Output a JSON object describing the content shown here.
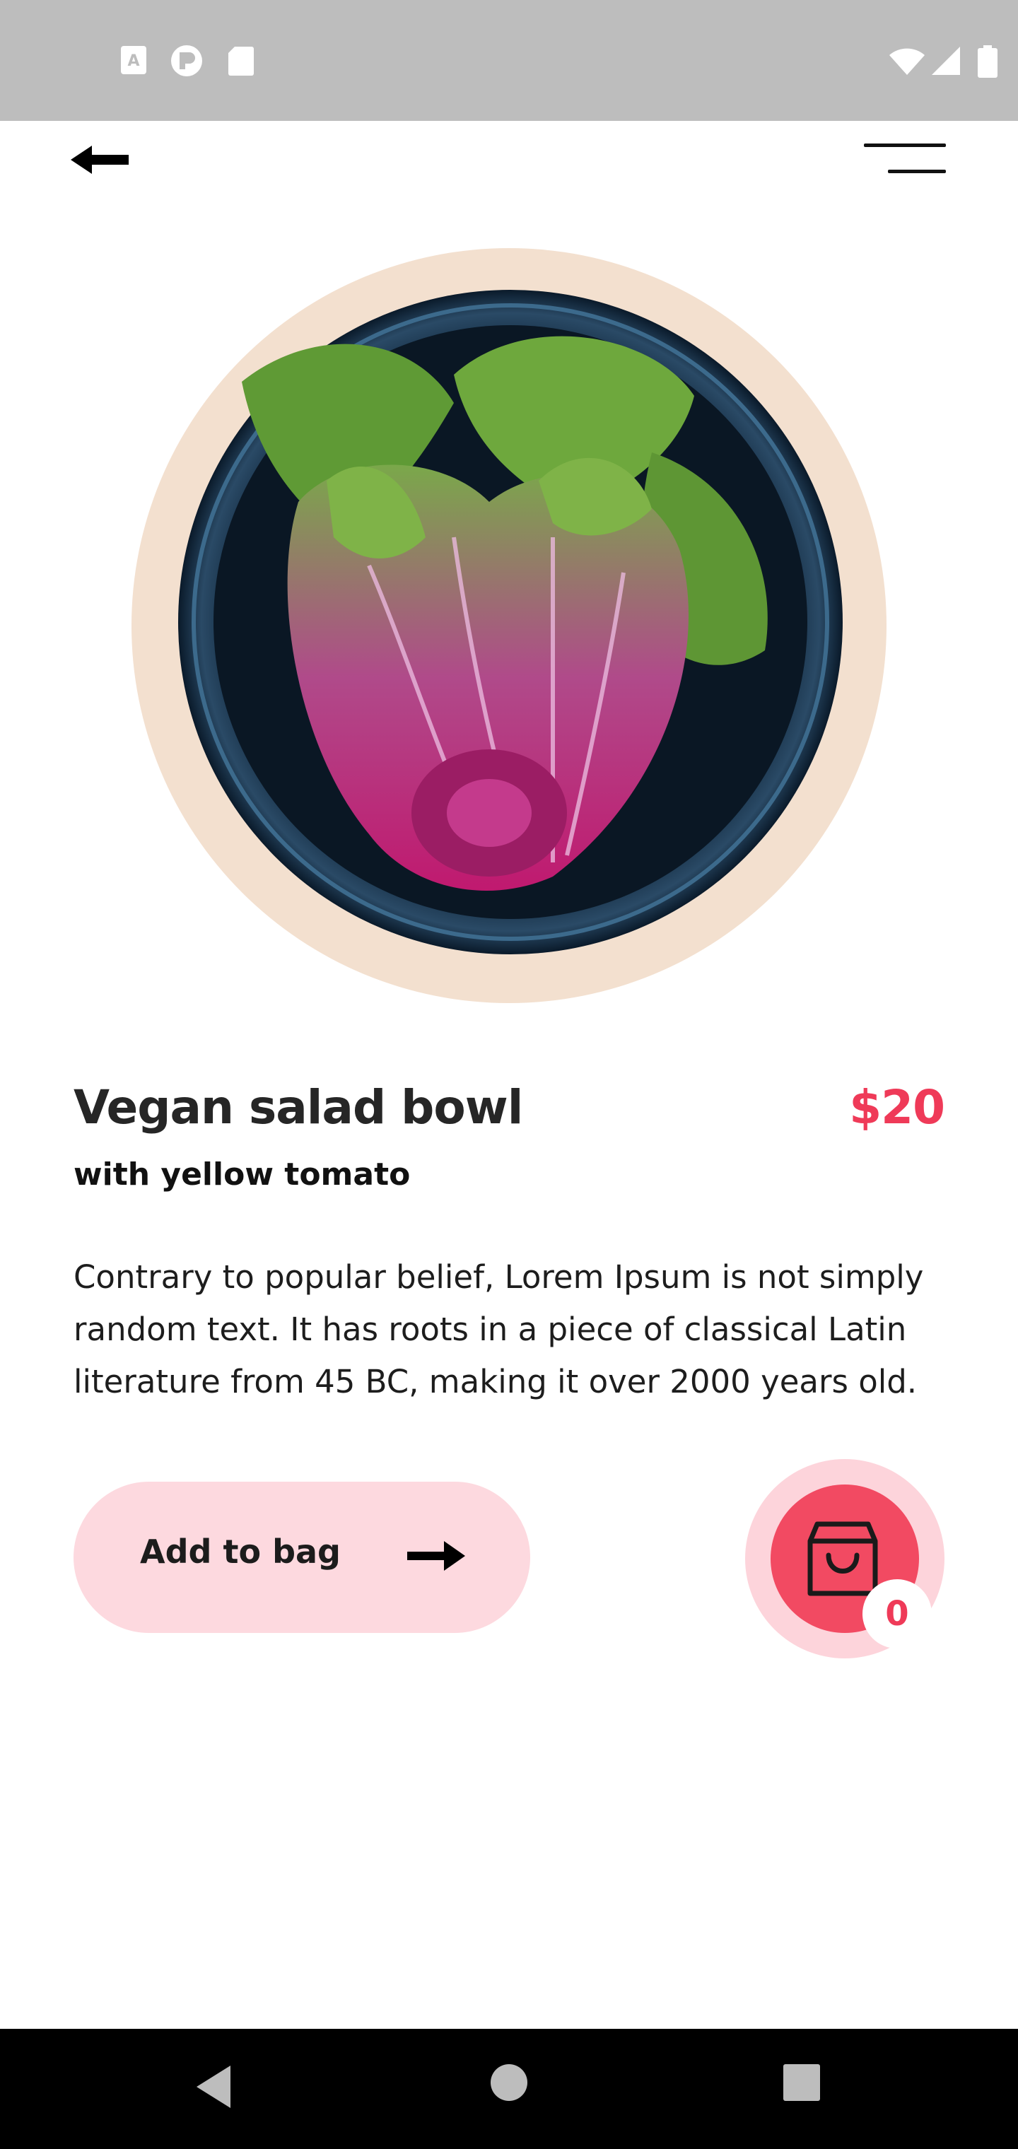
{
  "status_bar": {
    "left_icons": [
      "a-notification-icon",
      "p-notification-icon",
      "sd-card-icon"
    ],
    "right_icons": [
      "wifi-icon",
      "cell-signal-icon",
      "battery-icon"
    ]
  },
  "top_bar": {
    "back_icon": "arrow-left-icon",
    "menu_icon": "menu-lines-icon"
  },
  "product": {
    "title": "Vegan salad bowl",
    "subtitle": "with yellow tomato",
    "price": "$20",
    "description": "Contrary to popular belief, Lorem Ipsum is not simply random text. It has roots in a piece of classical Latin literature from 45 BC, making it over 2000 years old.",
    "image": "salad-bowl-image",
    "image_backdrop_color": "#f3e0cf"
  },
  "actions": {
    "add_to_bag_label": "Add to bag",
    "add_to_bag_icon": "arrow-right-icon",
    "cart_icon": "shopping-bag-icon",
    "cart_count": "0"
  },
  "colors": {
    "accent": "#ef3a58",
    "accent_light": "#fdd9df",
    "cart_fill": "#f24a62"
  },
  "nav_bar": {
    "icons": [
      "nav-back-icon",
      "nav-home-icon",
      "nav-recents-icon"
    ]
  }
}
